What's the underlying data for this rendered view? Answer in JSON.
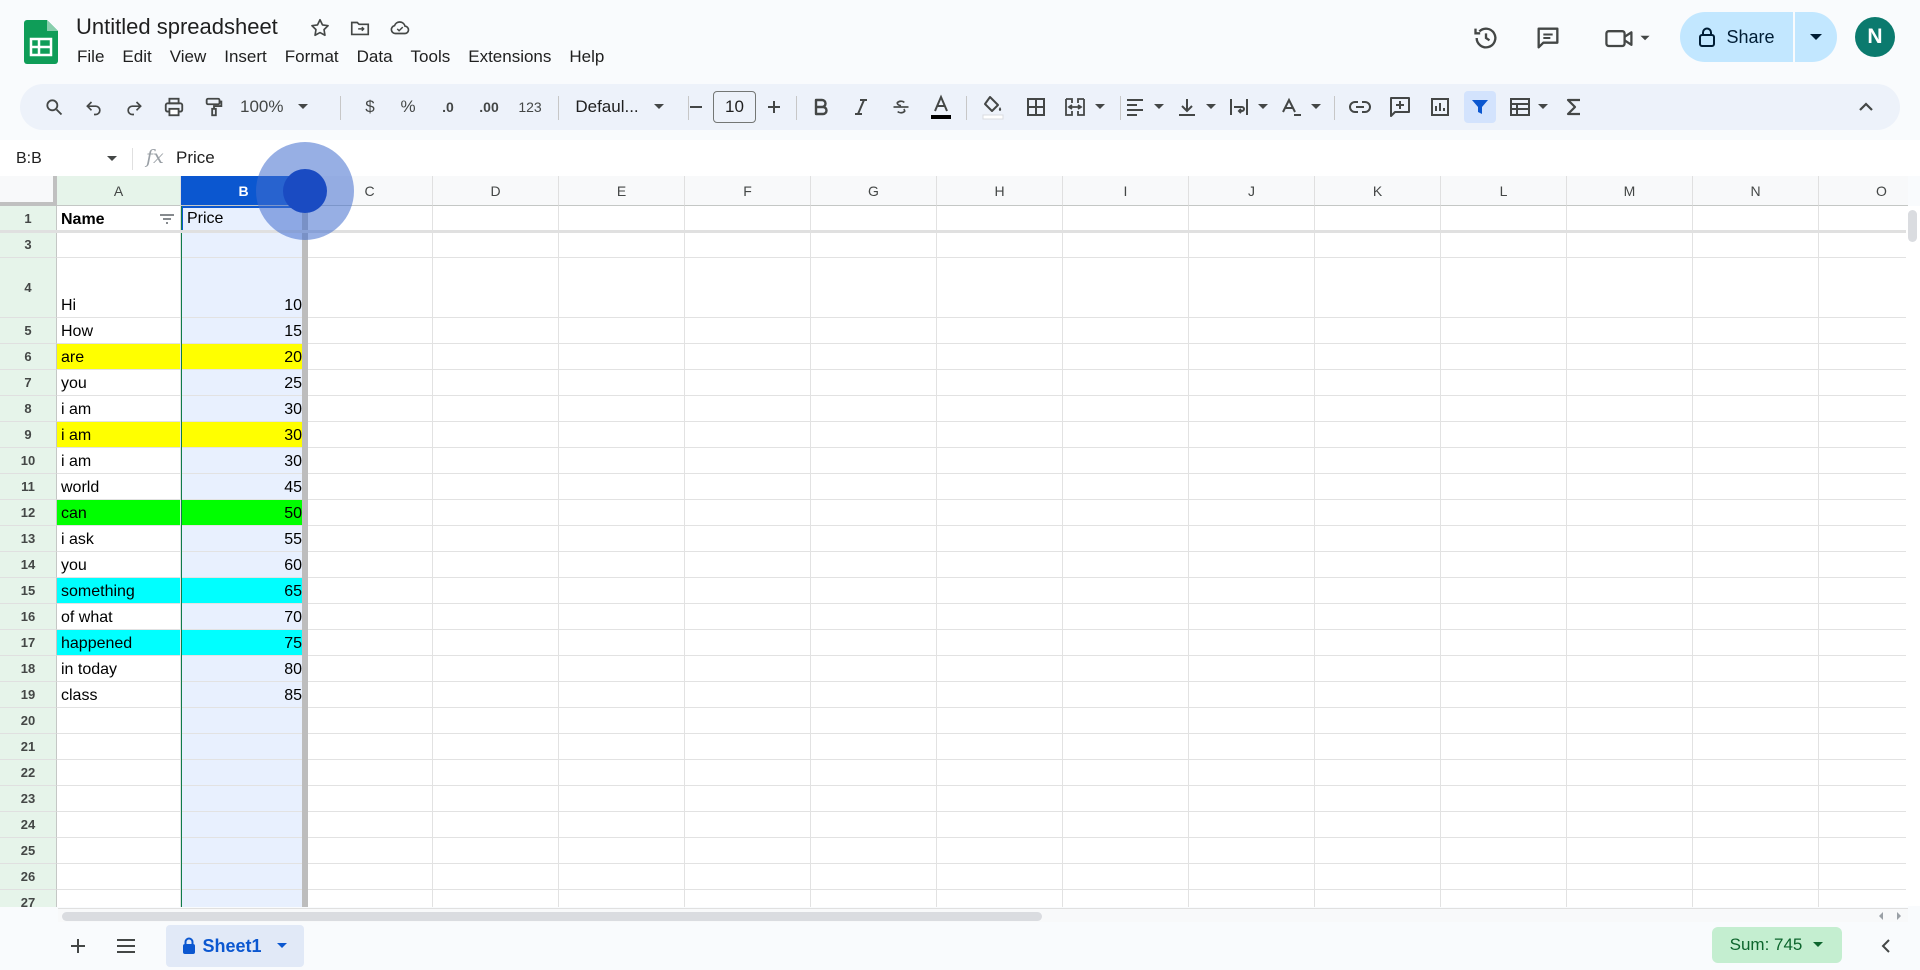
{
  "doc": {
    "title": "Untitled spreadsheet"
  },
  "menu": [
    "File",
    "Edit",
    "View",
    "Insert",
    "Format",
    "Data",
    "Tools",
    "Extensions",
    "Help"
  ],
  "share": {
    "label": "Share"
  },
  "avatar": {
    "initial": "N"
  },
  "toolbar": {
    "zoom": "100%",
    "currency": "$",
    "percent": "%",
    "dec_decrease": ".0",
    "dec_increase": ".00",
    "number_format": "123",
    "font": "Defaul...",
    "font_size": "10"
  },
  "formula": {
    "namebox": "B:B",
    "fx": "fx",
    "value": "Price"
  },
  "columns": [
    "A",
    "B",
    "C",
    "D",
    "E",
    "F",
    "G",
    "H",
    "I",
    "J",
    "K",
    "L",
    "M",
    "N",
    "O"
  ],
  "rows": [
    {
      "num": "1",
      "name": "Name",
      "price": "Price",
      "color": ""
    },
    {
      "num": "3",
      "name": "",
      "price": "",
      "color": ""
    },
    {
      "num": "4",
      "name": "Hi",
      "price": "10",
      "color": ""
    },
    {
      "num": "5",
      "name": "How",
      "price": "15",
      "color": ""
    },
    {
      "num": "6",
      "name": "are",
      "price": "20",
      "color": "#ffff00"
    },
    {
      "num": "7",
      "name": "you",
      "price": "25",
      "color": ""
    },
    {
      "num": "8",
      "name": "i am",
      "price": "30",
      "color": ""
    },
    {
      "num": "9",
      "name": "i am",
      "price": "30",
      "color": "#ffff00"
    },
    {
      "num": "10",
      "name": "i am",
      "price": "30",
      "color": ""
    },
    {
      "num": "11",
      "name": "world",
      "price": "45",
      "color": ""
    },
    {
      "num": "12",
      "name": "can",
      "price": "50",
      "color": "#00ff00"
    },
    {
      "num": "13",
      "name": "i ask",
      "price": "55",
      "color": ""
    },
    {
      "num": "14",
      "name": "you",
      "price": "60",
      "color": ""
    },
    {
      "num": "15",
      "name": "something",
      "price": "65",
      "color": "#00ffff"
    },
    {
      "num": "16",
      "name": "of what",
      "price": "70",
      "color": ""
    },
    {
      "num": "17",
      "name": "happened",
      "price": "75",
      "color": "#00ffff"
    },
    {
      "num": "18",
      "name": "in today",
      "price": "80",
      "color": ""
    },
    {
      "num": "19",
      "name": "class",
      "price": "85",
      "color": ""
    },
    {
      "num": "20",
      "name": "",
      "price": "",
      "color": ""
    },
    {
      "num": "21",
      "name": "",
      "price": "",
      "color": ""
    },
    {
      "num": "22",
      "name": "",
      "price": "",
      "color": ""
    },
    {
      "num": "23",
      "name": "",
      "price": "",
      "color": ""
    },
    {
      "num": "24",
      "name": "",
      "price": "",
      "color": ""
    },
    {
      "num": "25",
      "name": "",
      "price": "",
      "color": ""
    },
    {
      "num": "26",
      "name": "",
      "price": "",
      "color": ""
    },
    {
      "num": "27",
      "name": "",
      "price": "",
      "color": ""
    }
  ],
  "sheet": {
    "name": "Sheet1"
  },
  "status": {
    "sum": "Sum: 745"
  },
  "colors": {
    "selection": "#0b57d0",
    "selected_fill": "#e8f0fe",
    "filter_header": "#e6f4ea"
  }
}
